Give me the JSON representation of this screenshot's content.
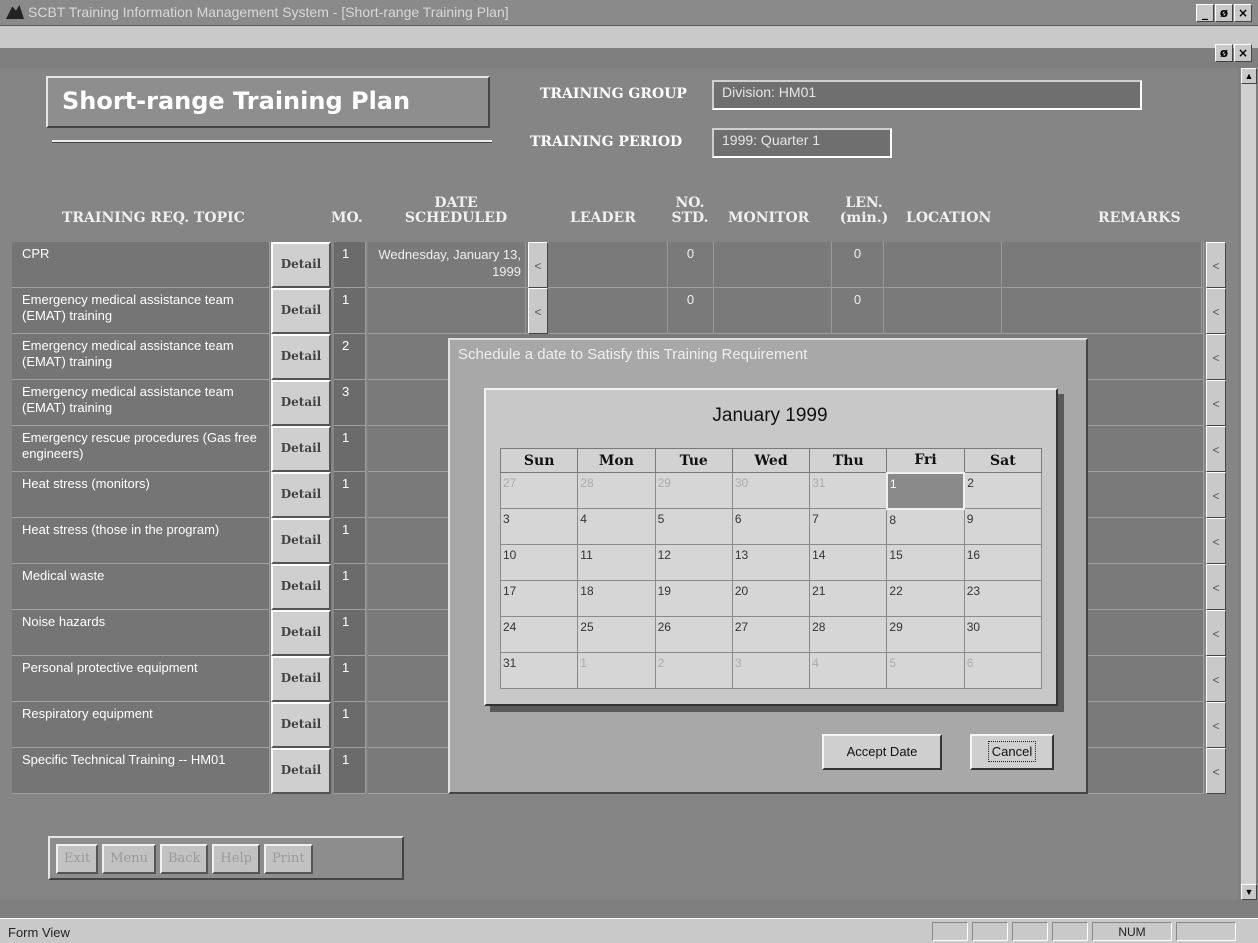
{
  "window": {
    "title": "SCBT Training Information Management System - [Short-range Training Plan]",
    "buttons": [
      "_",
      "ø",
      "×"
    ],
    "mdi_buttons": [
      "ø",
      "×"
    ]
  },
  "form": {
    "title": "Short-range Training Plan",
    "training_group_label": "TRAINING GROUP",
    "training_group_value": "Division: HM01",
    "training_period_label": "TRAINING PERIOD",
    "training_period_value": "1999: Quarter 1"
  },
  "columns": {
    "topic": "TRAINING REQ. TOPIC",
    "mo": "MO.",
    "date_line1": "DATE",
    "date_line2": "SCHEDULED",
    "leader": "LEADER",
    "nostd_line1": "NO.",
    "nostd_line2": "STD.",
    "monitor": "MONITOR",
    "len_line1": "LEN.",
    "len_line2": "(min.)",
    "location": "LOCATION",
    "remarks": "REMARKS"
  },
  "detail_label": "Detail",
  "left_arrow": "<",
  "rows": [
    {
      "topic": "CPR",
      "mo": "1",
      "date": "Wednesday, January 13, 1999",
      "std": "0",
      "len": "0"
    },
    {
      "topic": "Emergency medical assistance team (EMAT) training",
      "mo": "1",
      "date": "",
      "std": "0",
      "len": "0"
    },
    {
      "topic": "Emergency medical assistance team (EMAT) training",
      "mo": "2"
    },
    {
      "topic": "Emergency medical assistance team (EMAT) training",
      "mo": "3"
    },
    {
      "topic": "Emergency rescue procedures (Gas free engineers)",
      "mo": "1"
    },
    {
      "topic": "Heat stress (monitors)",
      "mo": "1"
    },
    {
      "topic": "Heat stress (those in the program)",
      "mo": "1"
    },
    {
      "topic": "Medical waste",
      "mo": "1"
    },
    {
      "topic": "Noise hazards",
      "mo": "1"
    },
    {
      "topic": "Personal protective equipment",
      "mo": "1"
    },
    {
      "topic": "Respiratory equipment",
      "mo": "1"
    },
    {
      "topic": "Specific Technical Training -- HM01",
      "mo": "1"
    }
  ],
  "dialog": {
    "title": "Schedule a date to Satisfy this Training Requirement",
    "month": "January 1999",
    "weekdays": [
      "Sun",
      "Mon",
      "Tue",
      "Wed",
      "Thu",
      "Fri",
      "Sat"
    ],
    "weeks": [
      [
        "27",
        "28",
        "29",
        "30",
        "31",
        "1",
        "2"
      ],
      [
        "3",
        "4",
        "5",
        "6",
        "7",
        "8",
        "9"
      ],
      [
        "10",
        "11",
        "12",
        "13",
        "14",
        "15",
        "16"
      ],
      [
        "17",
        "18",
        "19",
        "20",
        "21",
        "22",
        "23"
      ],
      [
        "24",
        "25",
        "26",
        "27",
        "28",
        "29",
        "30"
      ],
      [
        "31",
        "1",
        "2",
        "3",
        "4",
        "5",
        "6"
      ]
    ],
    "selected_day": "1",
    "accept_label": "Accept Date",
    "cancel_label": "Cancel"
  },
  "nav_buttons": [
    "Exit",
    "Menu",
    "Back",
    "Help",
    "Print"
  ],
  "status": {
    "text": "Form View",
    "num": "NUM"
  }
}
